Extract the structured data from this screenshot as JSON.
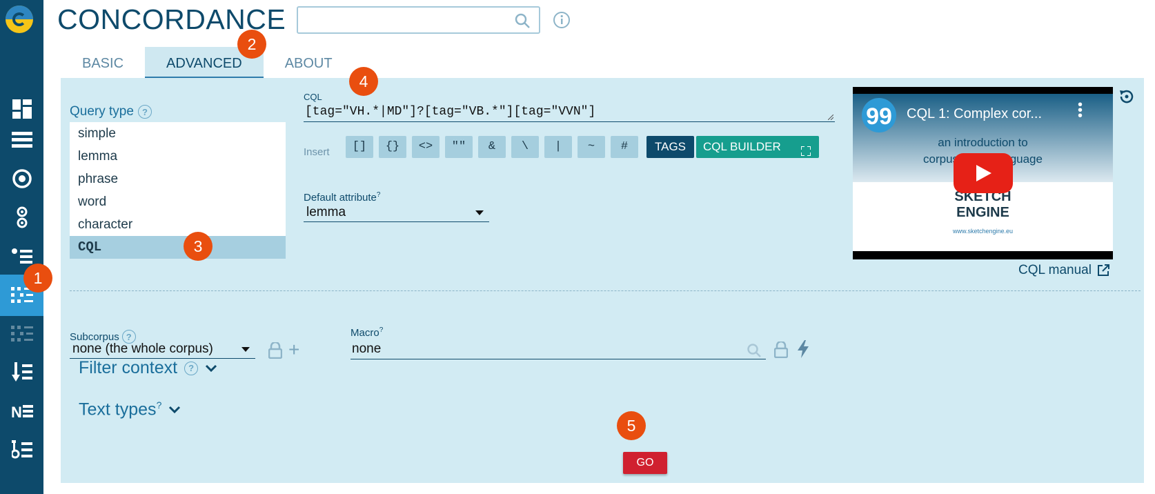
{
  "header": {
    "title": "CONCORDANCE",
    "search_value": ""
  },
  "tabs": [
    {
      "label": "BASIC",
      "active": false
    },
    {
      "label": "ADVANCED",
      "active": true
    },
    {
      "label": "ABOUT",
      "active": false
    }
  ],
  "query_type": {
    "label": "Query type",
    "help": "?",
    "options": [
      "simple",
      "lemma",
      "phrase",
      "word",
      "character",
      "CQL"
    ],
    "selected": "CQL"
  },
  "cql": {
    "label": "CQL",
    "value": "[tag=\"VH.*|MD\"]?[tag=\"VB.*\"][tag=\"VVN\"]",
    "insert_label": "Insert",
    "insert_buttons": [
      "[]",
      "{}",
      "<>",
      "\"\"",
      "&",
      "\\",
      "|",
      "~",
      "#"
    ],
    "tags_label": "TAGS",
    "builder_label": "CQL BUILDER"
  },
  "default_attribute": {
    "label": "Default attribute",
    "help": "?",
    "value": "lemma"
  },
  "video": {
    "title": "CQL 1: Complex cor...",
    "subtitle_line1": "an introduction to",
    "subtitle_line2": "corpus query language",
    "brand_line1": "SKETCH",
    "brand_line2": "ENGINE",
    "url": "www.sketchengine.eu",
    "channel_glyph": "99"
  },
  "cql_manual": "CQL manual",
  "subcorpus": {
    "label": "Subcorpus",
    "help": "?",
    "value": "none (the whole corpus)",
    "add": "+"
  },
  "macro": {
    "label": "Macro",
    "help": "?",
    "value": "none"
  },
  "filter_context": "Filter context",
  "text_types": {
    "label": "Text types",
    "help": "?"
  },
  "go_label": "GO",
  "markers": [
    "1",
    "2",
    "3",
    "4",
    "5"
  ],
  "colors": {
    "sidebar": "#0d4a6b",
    "sidebar_active": "#2e9ad6",
    "panel": "#d2ebf3",
    "go": "#d0202f",
    "builder": "#169e8e",
    "marker": "#e94e0f"
  }
}
